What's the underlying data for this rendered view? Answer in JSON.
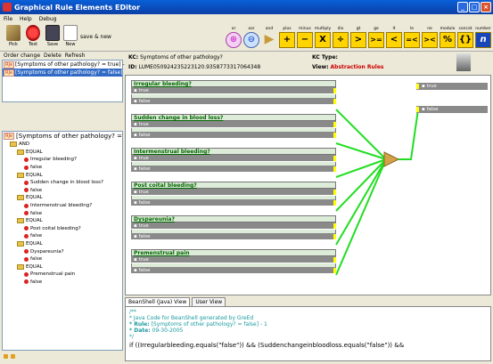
{
  "window": {
    "title": "Graphical Rule Elements EDitor"
  },
  "menu": [
    "File",
    "Help",
    "Debug"
  ],
  "toolbar": {
    "buttons": [
      {
        "label": "Pick",
        "icon": "pick-icon"
      },
      {
        "label": "Test",
        "icon": "test-icon"
      },
      {
        "label": "Save",
        "icon": "save-icon"
      },
      {
        "label": "New",
        "icon": "new-icon"
      }
    ],
    "save_new": "save & new"
  },
  "operators": [
    {
      "name": "or",
      "symbol": "⊕"
    },
    {
      "name": "xor",
      "symbol": "⊖"
    },
    {
      "name": "and",
      "symbol": "▶"
    },
    {
      "name": "plus",
      "symbol": "+"
    },
    {
      "name": "minus",
      "symbol": "−"
    },
    {
      "name": "multiply",
      "symbol": "X"
    },
    {
      "name": "div",
      "symbol": "÷"
    },
    {
      "name": "gt",
      "symbol": ">"
    },
    {
      "name": "ge",
      "symbol": ">="
    },
    {
      "name": "lt",
      "symbol": "<"
    },
    {
      "name": "le",
      "symbol": "=<"
    },
    {
      "name": "ne",
      "symbol": "><"
    },
    {
      "name": "modulo",
      "symbol": "%"
    },
    {
      "name": "concat",
      "symbol": "{}"
    },
    {
      "name": "number",
      "symbol": "n"
    }
  ],
  "rules": [
    {
      "label": "[Symptoms of other pathology? = true] - 1",
      "selected": false
    },
    {
      "label": "[Symptoms of other pathology? = false] - 1",
      "selected": true
    }
  ],
  "rule_toolbar": {
    "order_change": "Order change",
    "delete": "Delete",
    "refresh": "Refresh"
  },
  "tree": {
    "root": "[Symptoms of other pathology? = fals",
    "nodes": [
      {
        "depth": 1,
        "type": "folder",
        "label": "AND"
      },
      {
        "depth": 2,
        "type": "folder",
        "label": "EQUAL"
      },
      {
        "depth": 3,
        "type": "dot",
        "label": "Irregular bleeding?"
      },
      {
        "depth": 3,
        "type": "dot",
        "label": "false"
      },
      {
        "depth": 2,
        "type": "folder",
        "label": "EQUAL"
      },
      {
        "depth": 3,
        "type": "dot",
        "label": "Sudden change in blood loss?"
      },
      {
        "depth": 3,
        "type": "dot",
        "label": "false"
      },
      {
        "depth": 2,
        "type": "folder",
        "label": "EQUAL"
      },
      {
        "depth": 3,
        "type": "dot",
        "label": "Intermenstrual bleeding?"
      },
      {
        "depth": 3,
        "type": "dot",
        "label": "false"
      },
      {
        "depth": 2,
        "type": "folder",
        "label": "EQUAL"
      },
      {
        "depth": 3,
        "type": "dot",
        "label": "Post coital bleeding?"
      },
      {
        "depth": 3,
        "type": "dot",
        "label": "false"
      },
      {
        "depth": 2,
        "type": "folder",
        "label": "EQUAL"
      },
      {
        "depth": 3,
        "type": "dot",
        "label": "Dyspareunia?"
      },
      {
        "depth": 3,
        "type": "dot",
        "label": "false"
      },
      {
        "depth": 2,
        "type": "folder",
        "label": "EQUAL"
      },
      {
        "depth": 3,
        "type": "dot",
        "label": "Premenstrual pain"
      },
      {
        "depth": 3,
        "type": "dot",
        "label": "false"
      }
    ]
  },
  "info": {
    "kc_label": "KC:",
    "kc_value": "Symptoms of other pathology?",
    "id_label": "ID:",
    "id_value": "LUME050924235223120.9358773317064348",
    "kc_type_label": "KC Type:",
    "view_label": "View:",
    "view_value": "Abstraction Rules"
  },
  "canvas_nodes": [
    {
      "title": "Irregular bleeding?",
      "true": "true",
      "false": "false"
    },
    {
      "title": "Sudden change in blood loss?",
      "true": "true",
      "false": "false"
    },
    {
      "title": "Intermenstrual bleeding?",
      "true": "true",
      "false": "false"
    },
    {
      "title": "Post coital bleeding?",
      "true": "true",
      "false": "false"
    },
    {
      "title": "Dyspareunia?",
      "true": "true",
      "false": "false"
    },
    {
      "title": "Premenstrual pain",
      "true": "true",
      "false": "false"
    }
  ],
  "outputs": {
    "true": "true",
    "false": "false"
  },
  "editor": {
    "tabs": [
      "BeanShell (Java) View",
      "User View"
    ],
    "comment_open": "/**",
    "line1": " * Java Code for BeanShell generated by GreEd",
    "line2_key": " * Rule:",
    "line2_val": " [Symptoms of other pathology? = false] - 1",
    "line3_key": " * Date:",
    "line3_val": " 09-30-2005",
    "comment_close": " */",
    "code": "if ((Irregularbleeding.equals(\"false\")) && (Suddenchangeinbloodloss.equals(\"false\")) &&"
  },
  "colors": {
    "accent": "#316ac5",
    "node_header": "#ddecd8",
    "wire": "#22dd22",
    "operator_bg": "#ffd400"
  }
}
